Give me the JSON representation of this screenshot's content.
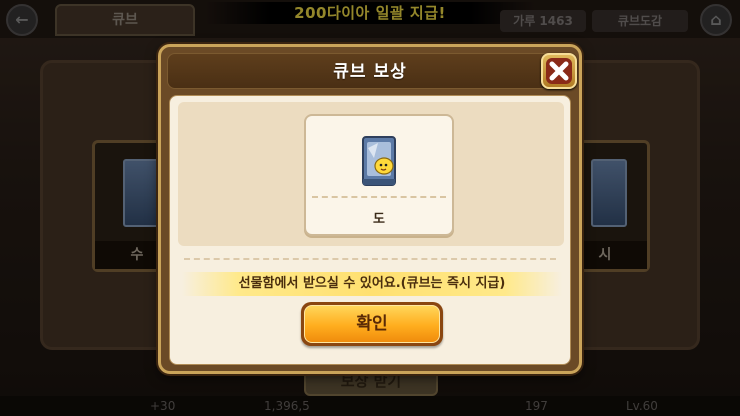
{
  "background": {
    "tab_label": "큐브",
    "banner_text": "200다이아 일괄 지급!",
    "right_pill_1": "가루 1463",
    "right_pill_2": "큐브도감",
    "card_left_label": "수",
    "card_right_label": "시",
    "bottom_button": "보상 받기",
    "status": {
      "plus_count": "+30",
      "coins": "1,396,5",
      "value_right": "197",
      "level": "Lv.60"
    }
  },
  "dialog": {
    "title": "큐브 보상",
    "reward": {
      "name": "도",
      "icon": "cookie-pack-icon"
    },
    "notice": "선물함에서 받으실 수 있어요.(큐브는 즉시 지급)",
    "confirm_label": "확인",
    "close_icon": "close-icon"
  },
  "colors": {
    "accent_orange": "#ffad1e",
    "close_red": "#8a2a18",
    "banner_yellow": "#ffe94a"
  }
}
